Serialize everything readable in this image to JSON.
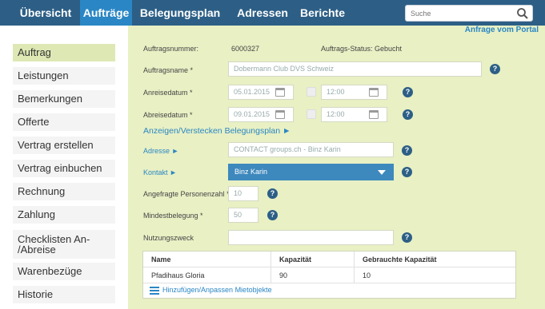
{
  "nav": {
    "items": [
      "Übersicht",
      "Aufträge",
      "Belegungsplan",
      "Adressen",
      "Berichte"
    ],
    "active_index": 1,
    "search_placeholder": "Suche"
  },
  "sidebar": {
    "items": [
      "Auftrag",
      "Leistungen",
      "Bemerkungen",
      "Offerte",
      "Vertrag erstellen",
      "Vertrag einbuchen",
      "Rechnung",
      "Zahlung",
      "Checklisten An-\n/Abreise",
      "Warenbezüge",
      "Historie"
    ],
    "active_index": 0
  },
  "form": {
    "portal_link": "Anfrage vom Portal",
    "order_number_label": "Auftragsnummer:",
    "order_number": "6000327",
    "status_label": "Auftrags-Status:",
    "status_value": "Gebucht",
    "order_name_label": "Auftragsname *",
    "order_name": "Dobermann Club DVS Schweiz",
    "arrival_label": "Anreisedatum *",
    "arrival_date": "05.01.2015",
    "arrival_time": "12:00",
    "departure_label": "Abreisedatum *",
    "departure_date": "09.01.2015",
    "departure_time": "12:00",
    "toggle_plan_link": "Anzeigen/Verstecken Belegungsplan ►",
    "address_label": "Adresse ►",
    "address_value": "CONTACT groups.ch - Binz Karin",
    "contact_label": "Kontakt ►",
    "contact_value": "Binz Karin",
    "persons_label": "Angefragte Personenzahl *",
    "persons_value": "10",
    "min_label": "Mindestbelegung *",
    "min_value": "50",
    "purpose_label": "Nutzungszweck",
    "purpose_value": "",
    "help_glyph": "?"
  },
  "table": {
    "headers": [
      "Name",
      "Kapazität",
      "Gebrauchte Kapazität"
    ],
    "rows": [
      [
        "Pfadihaus Gloria",
        "90",
        "10"
      ]
    ],
    "add_link": "Hinzufügen/Anpassen Mietobjekte"
  },
  "colors": {
    "nav_bg": "#2d5f86",
    "nav_active": "#2a86c4",
    "panel_bg": "#e8f0c4",
    "sidebar_active": "#dde8b4",
    "help_icon": "#2d5f86",
    "select_bg": "#3d88bd"
  }
}
